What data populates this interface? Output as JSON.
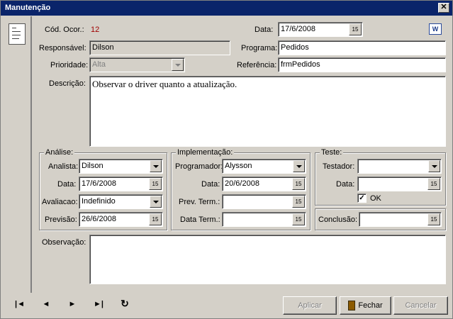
{
  "window": {
    "title": "Manutenção",
    "close_label": "✕"
  },
  "header": {
    "cod_label": "Cód. Ocor.:",
    "cod_value": "12",
    "data_label": "Data:",
    "data_value": "17/6/2008",
    "responsavel_label": "Responsável:",
    "responsavel_value": "Dilson",
    "programa_label": "Programa:",
    "programa_value": "Pedidos",
    "prioridade_label": "Prioridade:",
    "prioridade_value": "Alta",
    "referencia_label": "Referência:",
    "referencia_value": "frmPedidos",
    "descricao_label": "Descrição:",
    "descricao_value": "Observar o driver quanto a atualização."
  },
  "analise": {
    "title": "Análise:",
    "analista_label": "Analista:",
    "analista_value": "Dilson",
    "data_label": "Data:",
    "data_value": "17/6/2008",
    "avaliacao_label": "Avaliacao:",
    "avaliacao_value": "Indefinido",
    "previsao_label": "Previsão:",
    "previsao_value": "26/6/2008"
  },
  "implementacao": {
    "title": "Implementação:",
    "programador_label": "Programador:",
    "programador_value": "Alysson",
    "data_label": "Data:",
    "data_value": "20/6/2008",
    "prev_term_label": "Prev. Term.:",
    "prev_term_value": "",
    "data_term_label": "Data Term.:",
    "data_term_value": ""
  },
  "teste": {
    "title": "Teste:",
    "testador_label": "Testador:",
    "testador_value": "",
    "data_label": "Data:",
    "data_value": "",
    "ok_label": "OK",
    "ok_checked": "✓",
    "conclusao_label": "Conclusão:",
    "conclusao_value": ""
  },
  "observacao": {
    "label": "Observação:",
    "value": ""
  },
  "calendar_glyph": "15",
  "word_glyph": "W",
  "nav": {
    "first": "|◄",
    "prev": "◄",
    "next": "►",
    "last": "►|",
    "refresh": "↻"
  },
  "buttons": {
    "aplicar": "Aplicar",
    "fechar": "Fechar",
    "cancelar": "Cancelar"
  },
  "icons": [
    "document-icon",
    "word-icon",
    "calendar-icon",
    "dropdown-arrow-icon",
    "door-icon"
  ]
}
